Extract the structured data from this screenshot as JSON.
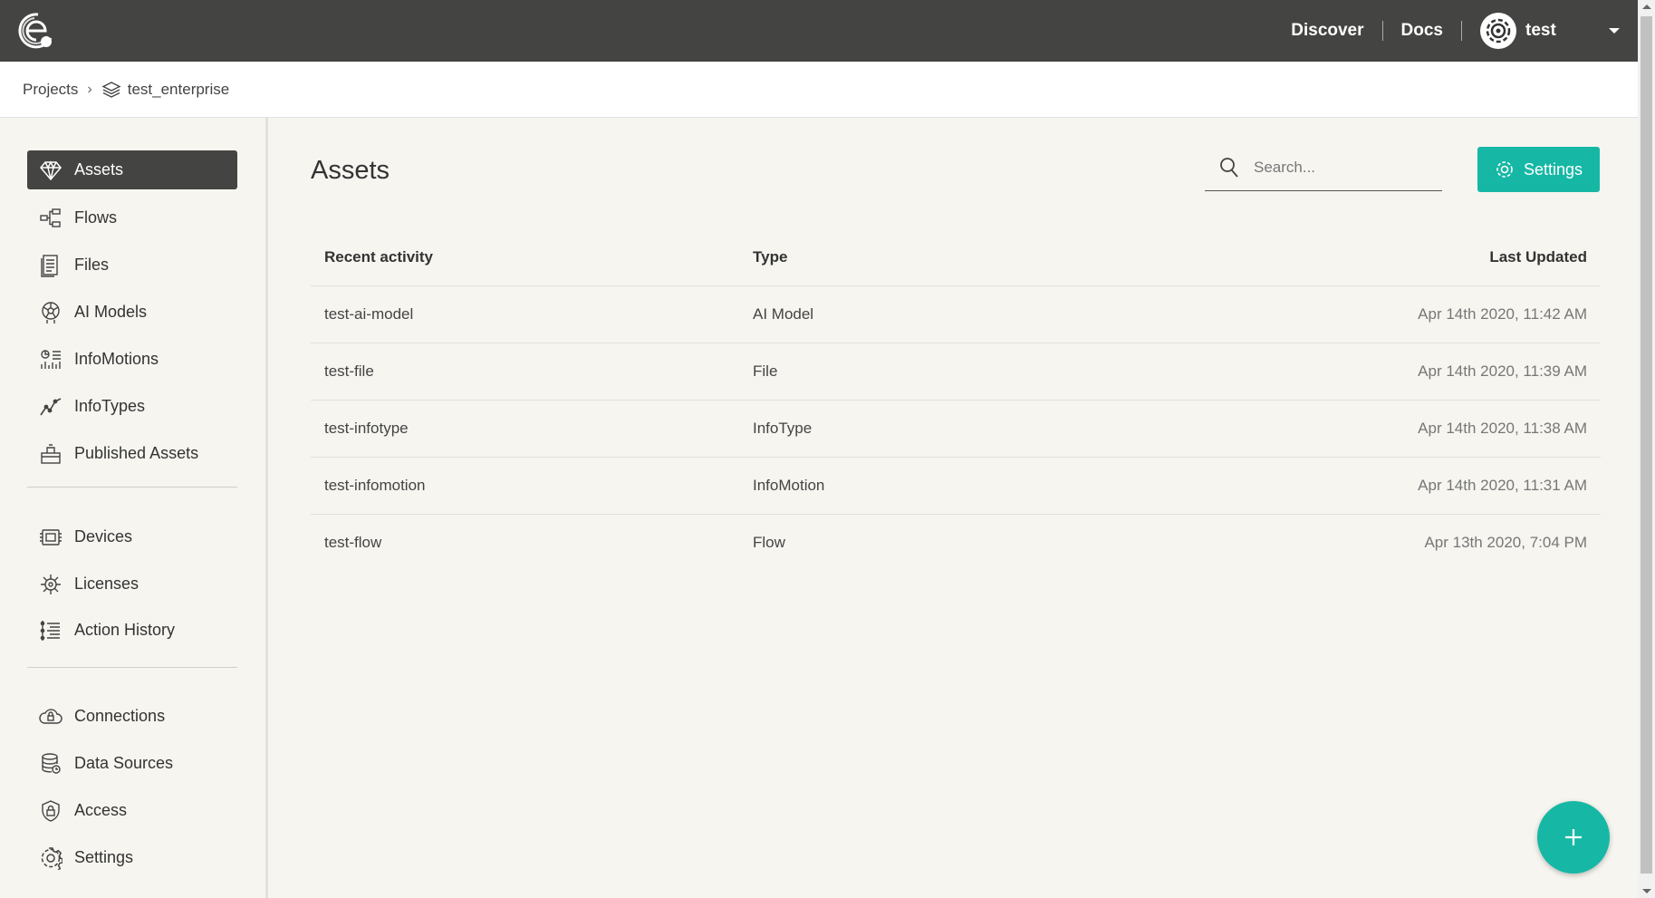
{
  "topbar": {
    "links": {
      "discover": "Discover",
      "docs": "Docs"
    },
    "user": {
      "name": "test"
    }
  },
  "breadcrumb": {
    "root": "Projects",
    "separator": "›",
    "current": "test_enterprise"
  },
  "sidebar": {
    "items": [
      {
        "label": "Assets",
        "icon": "diamond-icon",
        "active": true
      },
      {
        "label": "Flows",
        "icon": "flows-icon"
      },
      {
        "label": "Files",
        "icon": "files-icon"
      },
      {
        "label": "AI Models",
        "icon": "ai-models-icon"
      },
      {
        "label": "InfoMotions",
        "icon": "infomotions-icon"
      },
      {
        "label": "InfoTypes",
        "icon": "infotypes-icon"
      },
      {
        "label": "Published Assets",
        "icon": "published-assets-icon"
      },
      {
        "label": "Devices",
        "icon": "devices-icon"
      },
      {
        "label": "Licenses",
        "icon": "licenses-icon"
      },
      {
        "label": "Action History",
        "icon": "action-history-icon"
      },
      {
        "label": "Connections",
        "icon": "cloud-icon"
      },
      {
        "label": "Data Sources",
        "icon": "database-icon"
      },
      {
        "label": "Access",
        "icon": "shield-lock-icon"
      },
      {
        "label": "Settings",
        "icon": "gear-icon"
      }
    ]
  },
  "main": {
    "title": "Assets",
    "search": {
      "placeholder": "Search...",
      "value": ""
    },
    "settings_button": "Settings",
    "table": {
      "headers": [
        "Recent activity",
        "Type",
        "Last Updated"
      ],
      "rows": [
        [
          "test-ai-model",
          "AI Model",
          "Apr 14th 2020, 11:42 AM"
        ],
        [
          "test-file",
          "File",
          "Apr 14th 2020, 11:39 AM"
        ],
        [
          "test-infotype",
          "InfoType",
          "Apr 14th 2020, 11:38 AM"
        ],
        [
          "test-infomotion",
          "InfoMotion",
          "Apr 14th 2020, 11:31 AM"
        ],
        [
          "test-flow",
          "Flow",
          "Apr 13th 2020, 7:04 PM"
        ]
      ]
    },
    "fab_icon": "plus-icon"
  },
  "colors": {
    "accent": "#16b8a5",
    "topbar": "#444442",
    "background": "#f6f5f0"
  }
}
